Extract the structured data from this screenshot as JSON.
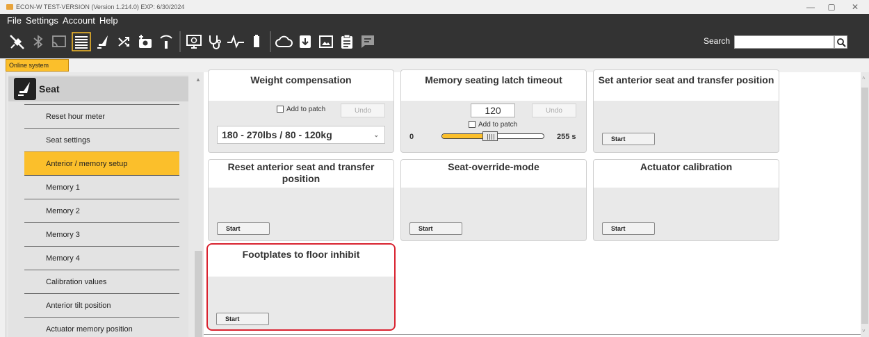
{
  "window": {
    "title": "ECON-W TEST-VERSION (Version 1.214.0) EXP: 6/30/2024",
    "controls": {
      "minimize": "—",
      "maximize": "▢",
      "close": "✕"
    }
  },
  "menu": [
    "File",
    "Settings",
    "Account",
    "Help"
  ],
  "toolbar": {
    "icons": [
      "disconnect-icon",
      "bluetooth-icon",
      "cast-icon",
      "list-icon",
      "seat-icon",
      "shuffle-icon",
      "camera-plus-icon",
      "wifi-alert-icon",
      "monitor-icon",
      "stethoscope-icon",
      "pulse-icon",
      "battery-icon",
      "cloud-icon",
      "download-icon",
      "image-icon",
      "clipboard-icon",
      "message-icon"
    ],
    "search_label": "Search",
    "search_value": ""
  },
  "online_tab": "Online system",
  "sidebar": {
    "title": "Seat",
    "items": [
      {
        "label": "Reset hour meter",
        "active": false
      },
      {
        "label": "Seat settings",
        "active": false
      },
      {
        "label": "Anterior / memory setup",
        "active": true
      },
      {
        "label": "Memory 1",
        "active": false
      },
      {
        "label": "Memory 2",
        "active": false
      },
      {
        "label": "Memory 3",
        "active": false
      },
      {
        "label": "Memory 4",
        "active": false
      },
      {
        "label": "Calibration values",
        "active": false
      },
      {
        "label": "Anterior tilt position",
        "active": false
      },
      {
        "label": "Actuator memory position",
        "active": false
      }
    ]
  },
  "cards": {
    "weight": {
      "title": "Weight compensation",
      "add_to_patch": "Add to patch",
      "undo": "Undo",
      "selected": "180 - 270lbs / 80 - 120kg"
    },
    "memory_latch": {
      "title": "Memory seating latch timeout",
      "value": "120",
      "undo": "Undo",
      "add_to_patch": "Add to patch",
      "min": "0",
      "max": "255 s",
      "level": 0.47
    },
    "set_anterior": {
      "title": "Set anterior seat and transfer position",
      "button": "Start"
    },
    "reset_anterior": {
      "title": "Reset anterior seat and transfer position",
      "button": "Start"
    },
    "seat_override": {
      "title": "Seat-override-mode",
      "button": "Start"
    },
    "actuator_cal": {
      "title": "Actuator calibration",
      "button": "Start"
    },
    "footplates": {
      "title": "Footplates to floor inhibit",
      "button": "Start"
    }
  },
  "colors": {
    "accent": "#fbbf2b",
    "toolbar_bg": "#333333",
    "highlight": "#d9222f"
  }
}
